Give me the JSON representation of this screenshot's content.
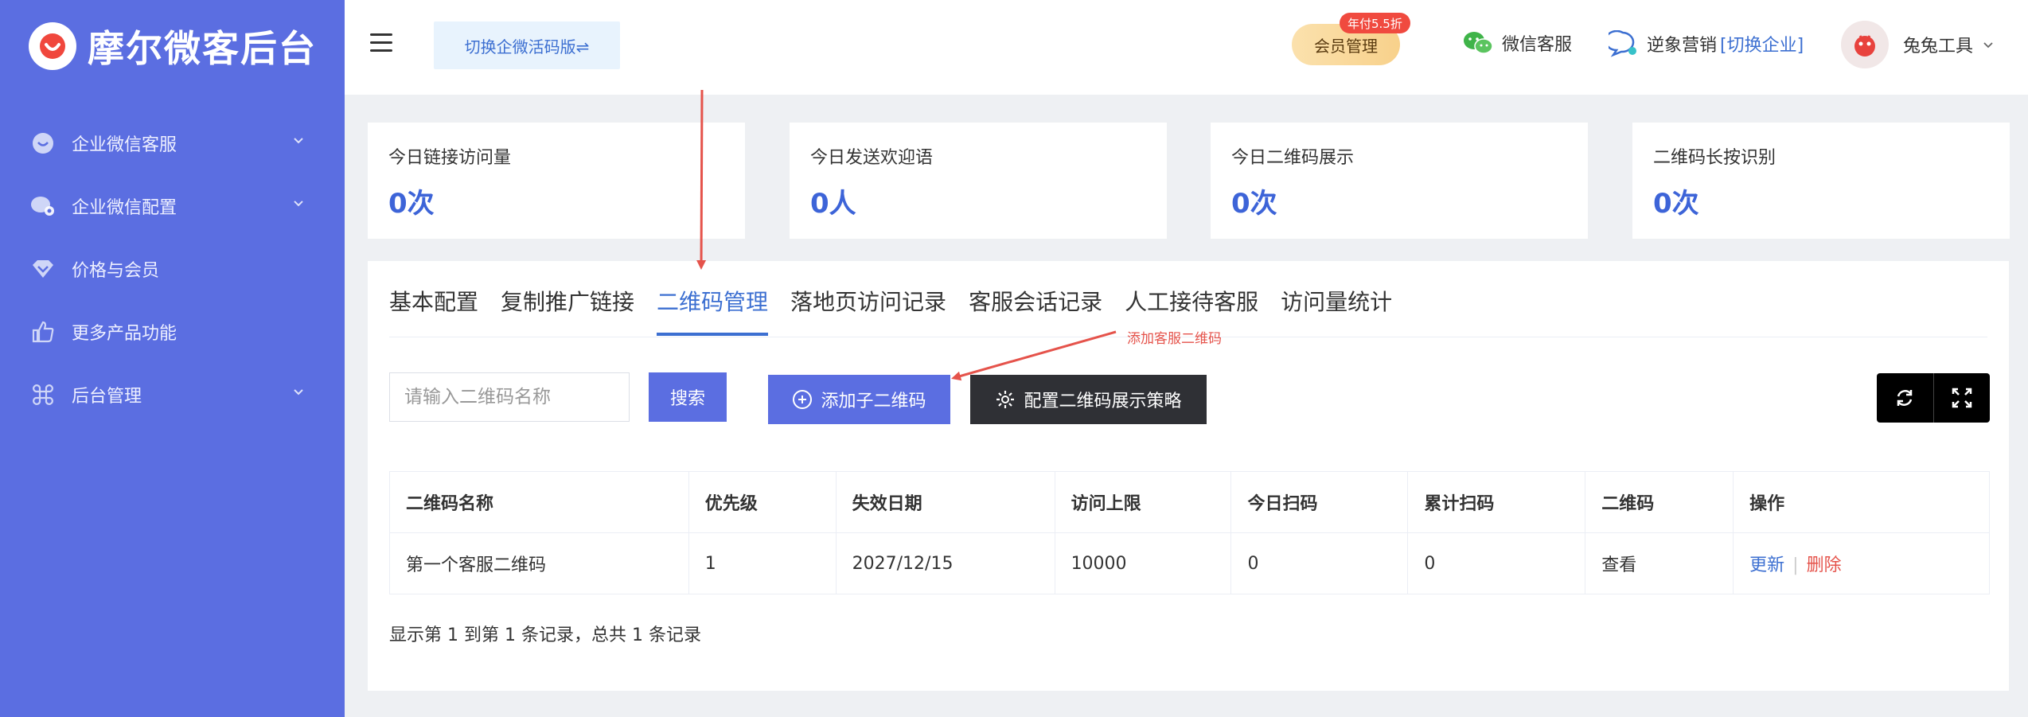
{
  "brand": {
    "name": "摩尔微客后台"
  },
  "sidebar": {
    "items": [
      {
        "label": "企业微信客服",
        "icon": "smile-chat-icon",
        "has_children": true
      },
      {
        "label": "企业微信配置",
        "icon": "chat-settings-icon",
        "has_children": true
      },
      {
        "label": "价格与会员",
        "icon": "diamond-icon",
        "has_children": false
      },
      {
        "label": "更多产品功能",
        "icon": "thumbs-up-icon",
        "has_children": false
      },
      {
        "label": "后台管理",
        "icon": "command-icon",
        "has_children": true
      }
    ]
  },
  "header": {
    "switch_label": "切换企微活码版⇌",
    "vip_label": "会员管理",
    "vip_badge": "年付5.5折",
    "wechat_service": "微信客服",
    "company": "逆象营销",
    "switch_company": "[切换企业]",
    "user_name": "兔兔工具"
  },
  "stats": [
    {
      "label": "今日链接访问量",
      "value": "0次"
    },
    {
      "label": "今日发送欢迎语",
      "value": "0人"
    },
    {
      "label": "今日二维码展示",
      "value": "0次"
    },
    {
      "label": "二维码长按识别",
      "value": "0次"
    }
  ],
  "tabs": [
    {
      "label": "基本配置"
    },
    {
      "label": "复制推广链接"
    },
    {
      "label": "二维码管理",
      "active": true
    },
    {
      "label": "落地页访问记录"
    },
    {
      "label": "客服会话记录"
    },
    {
      "label": "人工接待客服"
    },
    {
      "label": "访问量统计"
    }
  ],
  "toolbar": {
    "search_placeholder": "请输入二维码名称",
    "search_label": "搜索",
    "add_label": "添加子二维码",
    "config_label": "配置二维码展示策略"
  },
  "table": {
    "columns": [
      "二维码名称",
      "优先级",
      "失效日期",
      "访问上限",
      "今日扫码",
      "累计扫码",
      "二维码",
      "操作"
    ],
    "rows": [
      {
        "name": "第一个客服二维码",
        "priority": "1",
        "expire": "2027/12/15",
        "limit": "10000",
        "today": "0",
        "total": "0",
        "qrcode": "查看",
        "edit": "更新",
        "delete": "删除"
      }
    ]
  },
  "footer": {
    "info": "显示第 1 到第 1 条记录，总共 1 条记录"
  },
  "annotation": {
    "text": "添加客服二维码"
  },
  "colors": {
    "sidebar": "#5b6ee1",
    "accent": "#3c6fd1",
    "danger": "#e5534b",
    "dark_button": "#2f3035"
  }
}
